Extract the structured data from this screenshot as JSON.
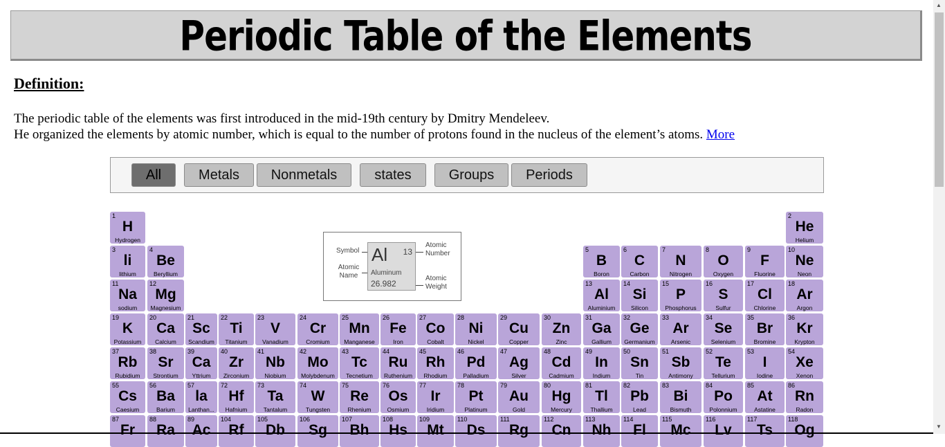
{
  "header": {
    "title": "Periodic Table of the Elements"
  },
  "definition": {
    "title": "Definition:",
    "line1": "The periodic table of the elements was first introduced in the mid-19th century by Dmitry Mendeleev.",
    "line2": "He organized the elements by atomic number, which is equal to the number of protons found in the nucleus of the element’s atoms.",
    "more_link": "More"
  },
  "filters": [
    {
      "label": "All",
      "active": true
    },
    {
      "label": "Metals",
      "active": false
    },
    {
      "label": "Nonmetals",
      "active": false
    },
    {
      "label": "states",
      "active": false
    },
    {
      "label": "Groups",
      "active": false
    },
    {
      "label": "Periods",
      "active": false
    }
  ],
  "legend": {
    "symbol": "Al",
    "number": "13",
    "name": "Aluminum",
    "weight": "26.982",
    "symbol_caption": "Symbol",
    "name_caption": "Atomic Name",
    "number_caption": "Atomic Number",
    "weight_caption": "Atomic Weight"
  },
  "colors": {
    "element_bg": "#b9a5d9",
    "header_bg": "#d3d3d3",
    "active_filter": "#6e6e6e",
    "filter_bg": "#c0c0c0"
  },
  "elements": [
    {
      "n": "1",
      "s": "H",
      "name": "Hydrogen",
      "row": 1,
      "col": 1
    },
    {
      "n": "2",
      "s": "He",
      "name": "Helium",
      "row": 1,
      "col": 18
    },
    {
      "n": "3",
      "s": "li",
      "name": "lithium",
      "row": 2,
      "col": 1
    },
    {
      "n": "4",
      "s": "Be",
      "name": "Beryllium",
      "row": 2,
      "col": 2
    },
    {
      "n": "5",
      "s": "B",
      "name": "Boron",
      "row": 2,
      "col": 13
    },
    {
      "n": "6",
      "s": "C",
      "name": "Carbon",
      "row": 2,
      "col": 14
    },
    {
      "n": "7",
      "s": "N",
      "name": "Nitrogen",
      "row": 2,
      "col": 15
    },
    {
      "n": "8",
      "s": "O",
      "name": "Oxygen",
      "row": 2,
      "col": 16
    },
    {
      "n": "9",
      "s": "F",
      "name": "Fluorine",
      "row": 2,
      "col": 17
    },
    {
      "n": "10",
      "s": "Ne",
      "name": "Neon",
      "row": 2,
      "col": 18
    },
    {
      "n": "11",
      "s": "Na",
      "name": "sodium",
      "row": 3,
      "col": 1
    },
    {
      "n": "12",
      "s": "Mg",
      "name": "Magnesium",
      "row": 3,
      "col": 2
    },
    {
      "n": "13",
      "s": "Al",
      "name": "Aluminium",
      "row": 3,
      "col": 13
    },
    {
      "n": "14",
      "s": "Si",
      "name": "Silicon",
      "row": 3,
      "col": 14
    },
    {
      "n": "15",
      "s": "P",
      "name": "Phosphorus",
      "row": 3,
      "col": 15
    },
    {
      "n": "16",
      "s": "S",
      "name": "Sulfur",
      "row": 3,
      "col": 16
    },
    {
      "n": "17",
      "s": "Cl",
      "name": "Chlorine",
      "row": 3,
      "col": 17
    },
    {
      "n": "18",
      "s": "Ar",
      "name": "Argon",
      "row": 3,
      "col": 18
    },
    {
      "n": "19",
      "s": "K",
      "name": "Potassium",
      "row": 4,
      "col": 1
    },
    {
      "n": "20",
      "s": "Ca",
      "name": "Calcium",
      "row": 4,
      "col": 2
    },
    {
      "n": "21",
      "s": "Sc",
      "name": "Scandium",
      "row": 4,
      "col": 3
    },
    {
      "n": "22",
      "s": "Ti",
      "name": "Titanium",
      "row": 4,
      "col": 4
    },
    {
      "n": "23",
      "s": "V",
      "name": "Vanadium",
      "row": 4,
      "col": 5
    },
    {
      "n": "24",
      "s": "Cr",
      "name": "Cromium",
      "row": 4,
      "col": 6
    },
    {
      "n": "25",
      "s": "Mn",
      "name": "Manganese",
      "row": 4,
      "col": 7
    },
    {
      "n": "26",
      "s": "Fe",
      "name": "Iron",
      "row": 4,
      "col": 8
    },
    {
      "n": "27",
      "s": "Co",
      "name": "Cobalt",
      "row": 4,
      "col": 9
    },
    {
      "n": "28",
      "s": "Ni",
      "name": "Nickel",
      "row": 4,
      "col": 10
    },
    {
      "n": "29",
      "s": "Cu",
      "name": "Copper",
      "row": 4,
      "col": 11
    },
    {
      "n": "30",
      "s": "Zn",
      "name": "Zinc",
      "row": 4,
      "col": 12
    },
    {
      "n": "31",
      "s": "Ga",
      "name": "Gallium",
      "row": 4,
      "col": 13
    },
    {
      "n": "32",
      "s": "Ge",
      "name": "Germanium",
      "row": 4,
      "col": 14
    },
    {
      "n": "33",
      "s": "Ar",
      "name": "Arsenic",
      "row": 4,
      "col": 15
    },
    {
      "n": "34",
      "s": "Se",
      "name": "Selenium",
      "row": 4,
      "col": 16
    },
    {
      "n": "35",
      "s": "Br",
      "name": "Bromine",
      "row": 4,
      "col": 17
    },
    {
      "n": "36",
      "s": "Kr",
      "name": "Krypton",
      "row": 4,
      "col": 18
    },
    {
      "n": "37",
      "s": "Rb",
      "name": "Rubidium",
      "row": 5,
      "col": 1
    },
    {
      "n": "38",
      "s": "Sr",
      "name": "Strontium",
      "row": 5,
      "col": 2
    },
    {
      "n": "39",
      "s": "Ca",
      "name": "Yttrium",
      "row": 5,
      "col": 3
    },
    {
      "n": "40",
      "s": "Zr",
      "name": "Zirconium",
      "row": 5,
      "col": 4
    },
    {
      "n": "41",
      "s": "Nb",
      "name": "Niobium",
      "row": 5,
      "col": 5
    },
    {
      "n": "42",
      "s": "Mo",
      "name": "Molybdenum",
      "row": 5,
      "col": 6
    },
    {
      "n": "43",
      "s": "Tc",
      "name": "Tecnetium",
      "row": 5,
      "col": 7
    },
    {
      "n": "44",
      "s": "Ru",
      "name": "Ruthenium",
      "row": 5,
      "col": 8
    },
    {
      "n": "45",
      "s": "Rh",
      "name": "Rhodium",
      "row": 5,
      "col": 9
    },
    {
      "n": "46",
      "s": "Pd",
      "name": "Palladium",
      "row": 5,
      "col": 10
    },
    {
      "n": "47",
      "s": "Ag",
      "name": "Silver",
      "row": 5,
      "col": 11
    },
    {
      "n": "48",
      "s": "Cd",
      "name": "Cadmium",
      "row": 5,
      "col": 12
    },
    {
      "n": "49",
      "s": "In",
      "name": "Indium",
      "row": 5,
      "col": 13
    },
    {
      "n": "50",
      "s": "Sn",
      "name": "Tin",
      "row": 5,
      "col": 14
    },
    {
      "n": "51",
      "s": "Sb",
      "name": "Antimony",
      "row": 5,
      "col": 15
    },
    {
      "n": "52",
      "s": "Te",
      "name": "Tellurium",
      "row": 5,
      "col": 16
    },
    {
      "n": "53",
      "s": "I",
      "name": "Iodine",
      "row": 5,
      "col": 17
    },
    {
      "n": "54",
      "s": "Xe",
      "name": "Xenon",
      "row": 5,
      "col": 18
    },
    {
      "n": "55",
      "s": "Cs",
      "name": "Caesium",
      "row": 6,
      "col": 1
    },
    {
      "n": "56",
      "s": "Ba",
      "name": "Barium",
      "row": 6,
      "col": 2
    },
    {
      "n": "57",
      "s": "la",
      "name": "Lanthan...",
      "row": 6,
      "col": 3
    },
    {
      "n": "72",
      "s": "Hf",
      "name": "Hafnium",
      "row": 6,
      "col": 4
    },
    {
      "n": "73",
      "s": "Ta",
      "name": "Tantalum",
      "row": 6,
      "col": 5
    },
    {
      "n": "74",
      "s": "W",
      "name": "Tungsten",
      "row": 6,
      "col": 6
    },
    {
      "n": "75",
      "s": "Re",
      "name": "Rhenium",
      "row": 6,
      "col": 7
    },
    {
      "n": "76",
      "s": "Os",
      "name": "Osmium",
      "row": 6,
      "col": 8
    },
    {
      "n": "77",
      "s": "Ir",
      "name": "Iridium",
      "row": 6,
      "col": 9
    },
    {
      "n": "78",
      "s": "Pt",
      "name": "Platinum",
      "row": 6,
      "col": 10
    },
    {
      "n": "79",
      "s": "Au",
      "name": "Gold",
      "row": 6,
      "col": 11
    },
    {
      "n": "80",
      "s": "Hg",
      "name": "Mercury",
      "row": 6,
      "col": 12
    },
    {
      "n": "81",
      "s": "Tl",
      "name": "Thallium",
      "row": 6,
      "col": 13
    },
    {
      "n": "82",
      "s": "Pb",
      "name": "Lead",
      "row": 6,
      "col": 14
    },
    {
      "n": "83",
      "s": "Bi",
      "name": "Bismuth",
      "row": 6,
      "col": 15
    },
    {
      "n": "84",
      "s": "Po",
      "name": "Polonnium",
      "row": 6,
      "col": 16
    },
    {
      "n": "85",
      "s": "At",
      "name": "Astatine",
      "row": 6,
      "col": 17
    },
    {
      "n": "86",
      "s": "Rn",
      "name": "Radon",
      "row": 6,
      "col": 18
    },
    {
      "n": "87",
      "s": "Fr",
      "name": "",
      "row": 7,
      "col": 1
    },
    {
      "n": "88",
      "s": "Ra",
      "name": "",
      "row": 7,
      "col": 2
    },
    {
      "n": "89",
      "s": "Ac",
      "name": "",
      "row": 7,
      "col": 3
    },
    {
      "n": "104",
      "s": "Rf",
      "name": "",
      "row": 7,
      "col": 4
    },
    {
      "n": "105",
      "s": "Db",
      "name": "",
      "row": 7,
      "col": 5
    },
    {
      "n": "106",
      "s": "Sg",
      "name": "",
      "row": 7,
      "col": 6
    },
    {
      "n": "107",
      "s": "Bh",
      "name": "",
      "row": 7,
      "col": 7
    },
    {
      "n": "108",
      "s": "Hs",
      "name": "",
      "row": 7,
      "col": 8
    },
    {
      "n": "109",
      "s": "Mt",
      "name": "",
      "row": 7,
      "col": 9
    },
    {
      "n": "110",
      "s": "Ds",
      "name": "",
      "row": 7,
      "col": 10
    },
    {
      "n": "111",
      "s": "Rg",
      "name": "",
      "row": 7,
      "col": 11
    },
    {
      "n": "112",
      "s": "Cn",
      "name": "",
      "row": 7,
      "col": 12
    },
    {
      "n": "113",
      "s": "Nh",
      "name": "",
      "row": 7,
      "col": 13
    },
    {
      "n": "114",
      "s": "Fl",
      "name": "",
      "row": 7,
      "col": 14
    },
    {
      "n": "115",
      "s": "Mc",
      "name": "",
      "row": 7,
      "col": 15
    },
    {
      "n": "116",
      "s": "Lv",
      "name": "",
      "row": 7,
      "col": 16
    },
    {
      "n": "117",
      "s": "Ts",
      "name": "",
      "row": 7,
      "col": 17
    },
    {
      "n": "118",
      "s": "Og",
      "name": "",
      "row": 7,
      "col": 18
    }
  ]
}
